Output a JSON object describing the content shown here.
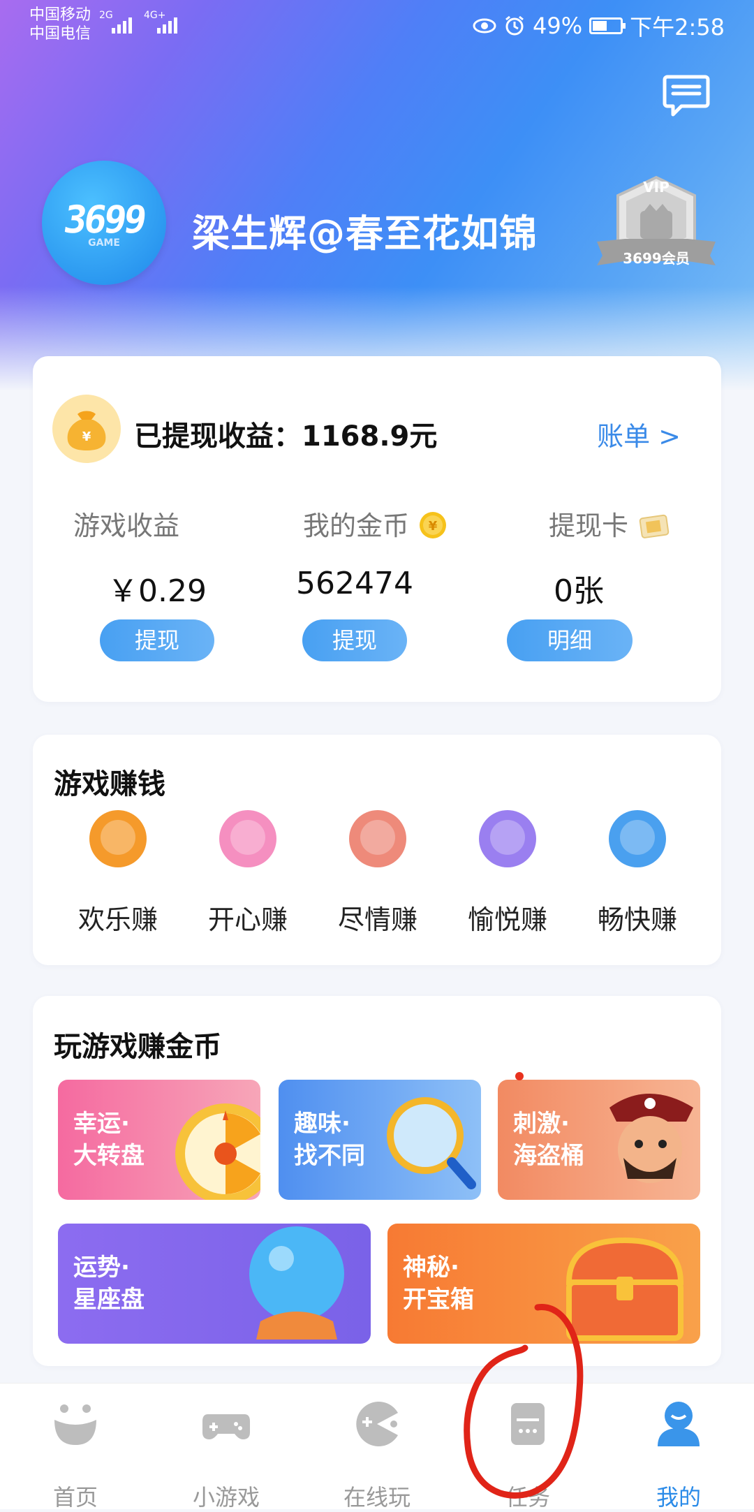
{
  "status_bar": {
    "carrier1": "中国移动",
    "carrier2": "中国电信",
    "net1": "2G",
    "net2": "4G+",
    "battery": "49%",
    "time": "下午2:58"
  },
  "header": {
    "avatar_text": "3699",
    "avatar_sub": "GAME",
    "username": "梁生辉@春至花如锦",
    "vip_top": "VIP",
    "vip_bottom": "3699会员"
  },
  "earnings": {
    "title": "已提现收益：1168.9元",
    "bill_link": "账单 >",
    "columns": [
      {
        "label": "游戏收益",
        "value": "￥0.29",
        "button": "提现"
      },
      {
        "label": "我的金币",
        "value": "562474",
        "button": "提现"
      },
      {
        "label": "提现卡",
        "value": "0张",
        "button": "明细"
      }
    ]
  },
  "games_section": {
    "title": "游戏赚钱",
    "items": [
      {
        "label": "欢乐赚",
        "color": "#f59a2b"
      },
      {
        "label": "开心赚",
        "color": "#f58fc0"
      },
      {
        "label": "尽情赚",
        "color": "#ee8a7a"
      },
      {
        "label": "愉悦赚",
        "color": "#9a7ff0"
      },
      {
        "label": "畅快赚",
        "color": "#4aa0ef"
      }
    ]
  },
  "coins_section": {
    "title": "玩游戏赚金币",
    "tiles": [
      {
        "line1": "幸运·",
        "line2": "大转盘"
      },
      {
        "line1": "趣味·",
        "line2": "找不同"
      },
      {
        "line1": "刺激·",
        "line2": "海盗桶"
      },
      {
        "line1": "运势·",
        "line2": "星座盘"
      },
      {
        "line1": "神秘·",
        "line2": "开宝箱"
      }
    ]
  },
  "bottom_nav": {
    "items": [
      {
        "label": "首页",
        "active": false
      },
      {
        "label": "小游戏",
        "active": false
      },
      {
        "label": "在线玩",
        "active": false
      },
      {
        "label": "任务",
        "active": false
      },
      {
        "label": "我的",
        "active": true
      }
    ]
  },
  "colors": {
    "accent": "#2b8be8",
    "annotation": "#e02418"
  }
}
